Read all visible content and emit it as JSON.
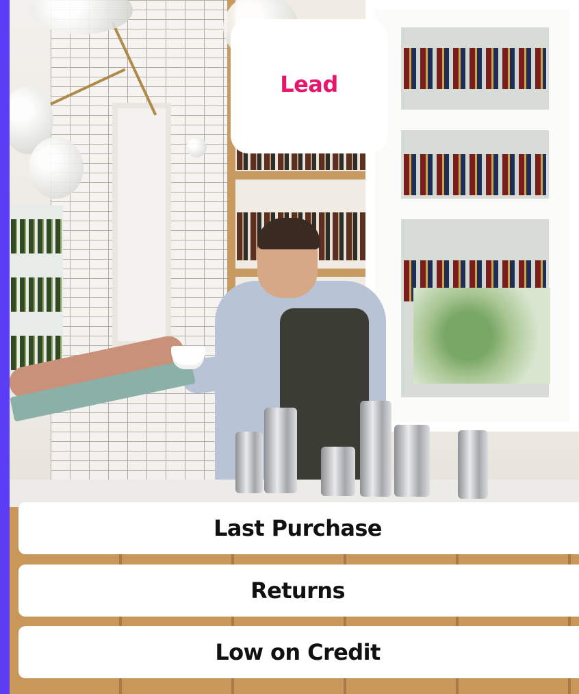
{
  "card": {
    "label": "Lead",
    "label_color": "#e5176d"
  },
  "options": [
    {
      "label": "Last Purchase"
    },
    {
      "label": "Returns"
    },
    {
      "label": "Low on Credit"
    }
  ],
  "colors": {
    "accent": "#5b3df5",
    "option_text": "#111111",
    "option_background": "#ffffff"
  },
  "background_image": {
    "icon": "bartender-photo"
  }
}
